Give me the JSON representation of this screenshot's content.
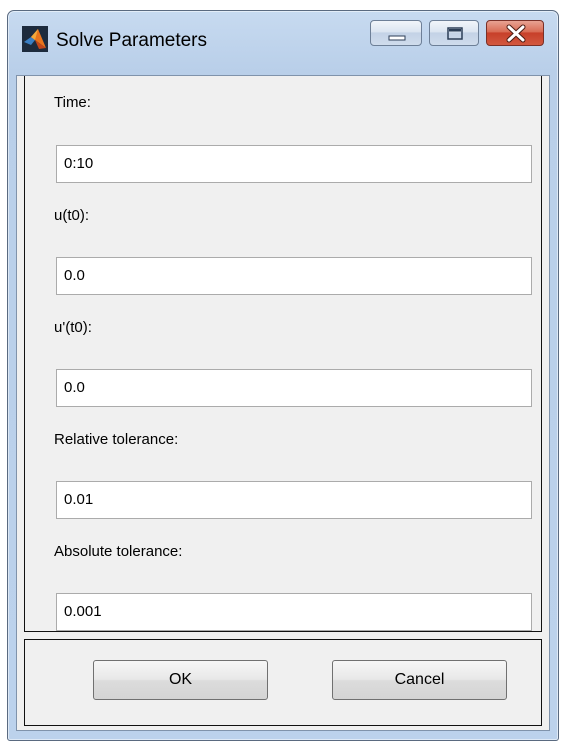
{
  "window": {
    "title": "Solve Parameters",
    "controls": {
      "minimize": "minimize-icon",
      "maximize": "maximize-icon",
      "close": "close-icon"
    },
    "app_icon": "matlab-logo-icon"
  },
  "fields": [
    {
      "label": "Time:",
      "value": "0:10"
    },
    {
      "label": "u(t0):",
      "value": "0.0"
    },
    {
      "label": "u'(t0):",
      "value": "0.0"
    },
    {
      "label": "Relative tolerance:",
      "value": "0.01"
    },
    {
      "label": "Absolute tolerance:",
      "value": "0.001"
    }
  ],
  "buttons": {
    "ok": "OK",
    "cancel": "Cancel"
  },
  "colors": {
    "close_button": "#c7402a",
    "frame": "#b9cfe9",
    "client_background": "#f0f0f0"
  }
}
